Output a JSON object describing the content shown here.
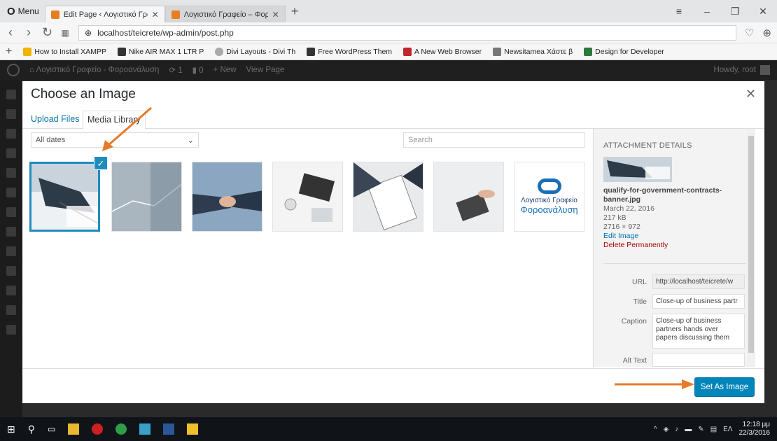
{
  "browser": {
    "menu_label": "Menu",
    "tabs": [
      {
        "title": "Edit Page ‹ Λογιστικό Γραφ"
      },
      {
        "title": "Λογιστικό Γραφείο – Φορο"
      }
    ],
    "url": "localhost/teicrete/wp-admin/post.php",
    "bookmarks": [
      "How to Install XAMPP",
      "Nike AIR MAX 1 LTR P",
      "Divi Layouts - Divi Th",
      "Free WordPress Them",
      "A New Web Browser",
      "Newsitamea Χάστε β",
      "Design for Developer"
    ]
  },
  "adminbar": {
    "site": "Λογιστικό Γραφείο - Φοροανάλυση",
    "updates": "1",
    "comments": "0",
    "new_label": "New",
    "view_label": "View Page",
    "howdy": "Howdy, root"
  },
  "modal": {
    "title": "Choose an Image",
    "tab_upload": "Upload Files",
    "tab_library": "Media Library",
    "filter_value": "All dates",
    "search_placeholder": "Search",
    "logo_thumb": {
      "line1": "Λογιστικό Γραφείο",
      "line2": "Φοροανάλυση"
    },
    "details": {
      "heading": "ATTACHMENT DETAILS",
      "filename": "qualify-for-government-contracts-banner.jpg",
      "date": "March 22, 2016",
      "size": "217 kB",
      "dimensions": "2716 × 972",
      "edit_link": "Edit Image",
      "delete_link": "Delete Permanently",
      "url_label": "URL",
      "url_value": "http://localhost/teicrete/w",
      "title_label": "Title",
      "title_value": "Close-up of business partr",
      "caption_label": "Caption",
      "caption_value": "Close-up of business partners hands over papers discussing them",
      "alt_label": "Alt Text",
      "alt_value": ""
    },
    "button_label": "Set As Image"
  },
  "taskbar": {
    "lang": "ΕΛ",
    "time": "12:18 μμ",
    "date": "22/3/2016"
  },
  "colors": {
    "accent": "#0085ba",
    "annotation": "#e87a2a"
  }
}
